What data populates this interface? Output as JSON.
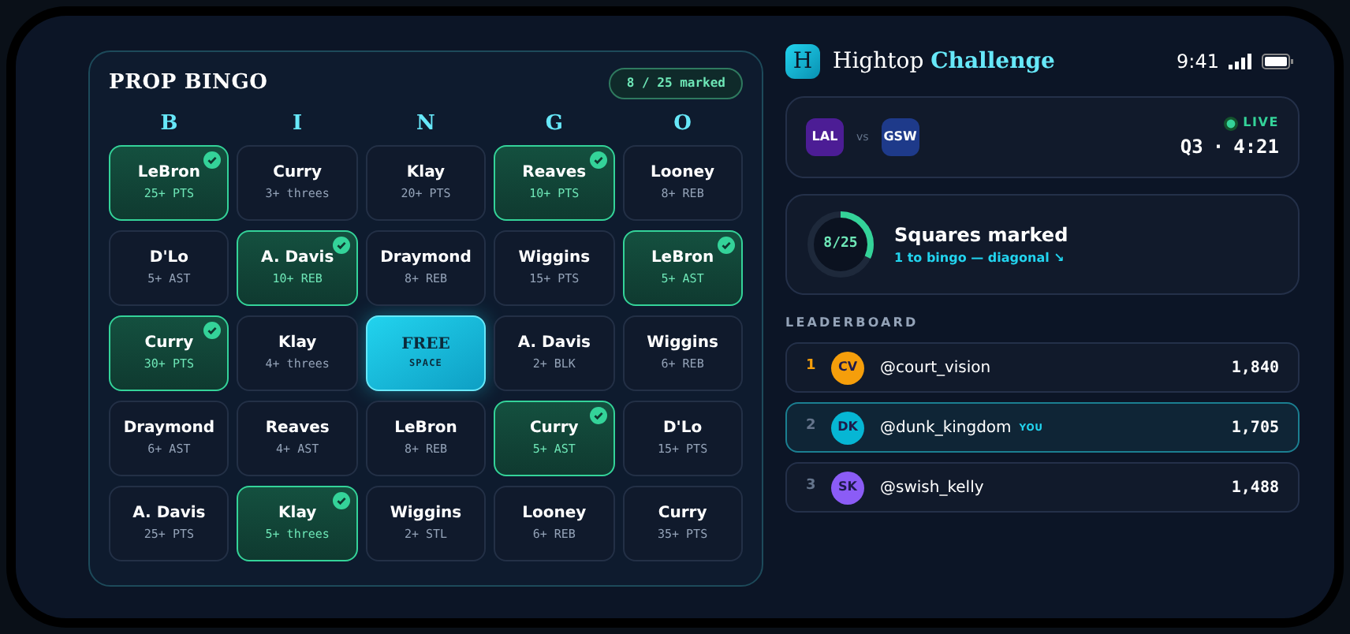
{
  "bingo": {
    "title": "PROP BINGO",
    "marked_badge": "8 / 25 marked",
    "letters": [
      "B",
      "I",
      "N",
      "G",
      "O"
    ],
    "cells": [
      {
        "kind": "prop",
        "player": "LeBron",
        "prop": "25+ PTS",
        "checked": true
      },
      {
        "kind": "prop",
        "player": "Curry",
        "prop": "3+ threes",
        "checked": false
      },
      {
        "kind": "prop",
        "player": "Klay",
        "prop": "20+ PTS",
        "checked": false
      },
      {
        "kind": "prop",
        "player": "Reaves",
        "prop": "10+ PTS",
        "checked": true
      },
      {
        "kind": "prop",
        "player": "Looney",
        "prop": "8+ REB",
        "checked": false
      },
      {
        "kind": "prop",
        "player": "D'Lo",
        "prop": "5+ AST",
        "checked": false
      },
      {
        "kind": "prop",
        "player": "A. Davis",
        "prop": "10+ REB",
        "checked": true
      },
      {
        "kind": "prop",
        "player": "Draymond",
        "prop": "8+ REB",
        "checked": false
      },
      {
        "kind": "prop",
        "player": "Wiggins",
        "prop": "15+ PTS",
        "checked": false
      },
      {
        "kind": "prop",
        "player": "LeBron",
        "prop": "5+ AST",
        "checked": true
      },
      {
        "kind": "prop",
        "player": "Curry",
        "prop": "30+ PTS",
        "checked": true
      },
      {
        "kind": "prop",
        "player": "Klay",
        "prop": "4+ threes",
        "checked": false
      },
      {
        "kind": "free",
        "player": "FREE",
        "prop": "SPACE"
      },
      {
        "kind": "prop",
        "player": "A. Davis",
        "prop": "2+ BLK",
        "checked": false
      },
      {
        "kind": "prop",
        "player": "Wiggins",
        "prop": "6+ REB",
        "checked": false
      },
      {
        "kind": "prop",
        "player": "Draymond",
        "prop": "6+ AST",
        "checked": false
      },
      {
        "kind": "prop",
        "player": "Reaves",
        "prop": "4+ AST",
        "checked": false
      },
      {
        "kind": "prop",
        "player": "LeBron",
        "prop": "8+ REB",
        "checked": false
      },
      {
        "kind": "prop",
        "player": "Curry",
        "prop": "5+ AST",
        "checked": true
      },
      {
        "kind": "prop",
        "player": "D'Lo",
        "prop": "15+ PTS",
        "checked": false
      },
      {
        "kind": "prop",
        "player": "A. Davis",
        "prop": "25+ PTS",
        "checked": false
      },
      {
        "kind": "prop",
        "player": "Klay",
        "prop": "5+ threes",
        "checked": true
      },
      {
        "kind": "prop",
        "player": "Wiggins",
        "prop": "2+ STL",
        "checked": false
      },
      {
        "kind": "prop",
        "player": "Looney",
        "prop": "6+ REB",
        "checked": false
      },
      {
        "kind": "prop",
        "player": "Curry",
        "prop": "35+ PTS",
        "checked": false
      }
    ]
  },
  "app": {
    "logo": "H",
    "name": "Hightop",
    "name_accent": "Challenge"
  },
  "status_bar": {
    "time": "9:41"
  },
  "game": {
    "home": {
      "abbr": "LAL",
      "color": "#4c1d95"
    },
    "vs": "vs",
    "away": {
      "abbr": "GSW",
      "color": "#1e3a8a"
    },
    "live": "LIVE",
    "period": "Q3",
    "separator": "·",
    "clock": "4:21"
  },
  "progress": {
    "ring_label": "8/25",
    "level": 0.32,
    "title": "Squares marked",
    "subtitle": "1 to bingo — diagonal ↘"
  },
  "leaderboard": {
    "heading": "LEADERBOARD",
    "rows": [
      {
        "rank": "1",
        "initials": "CV",
        "color": "#f59e0b",
        "handle": "@court_vision",
        "score": "1,840",
        "selected": false
      },
      {
        "rank": "2",
        "initials": "DK",
        "color": "#06b6d4",
        "handle": "@dunk_kingdom",
        "you": "YOU",
        "score": "1,705",
        "selected": true
      },
      {
        "rank": "3",
        "initials": "SK",
        "color": "#8b5cf6",
        "handle": "@swish_kelly",
        "score": "1,488",
        "selected": false
      }
    ]
  }
}
